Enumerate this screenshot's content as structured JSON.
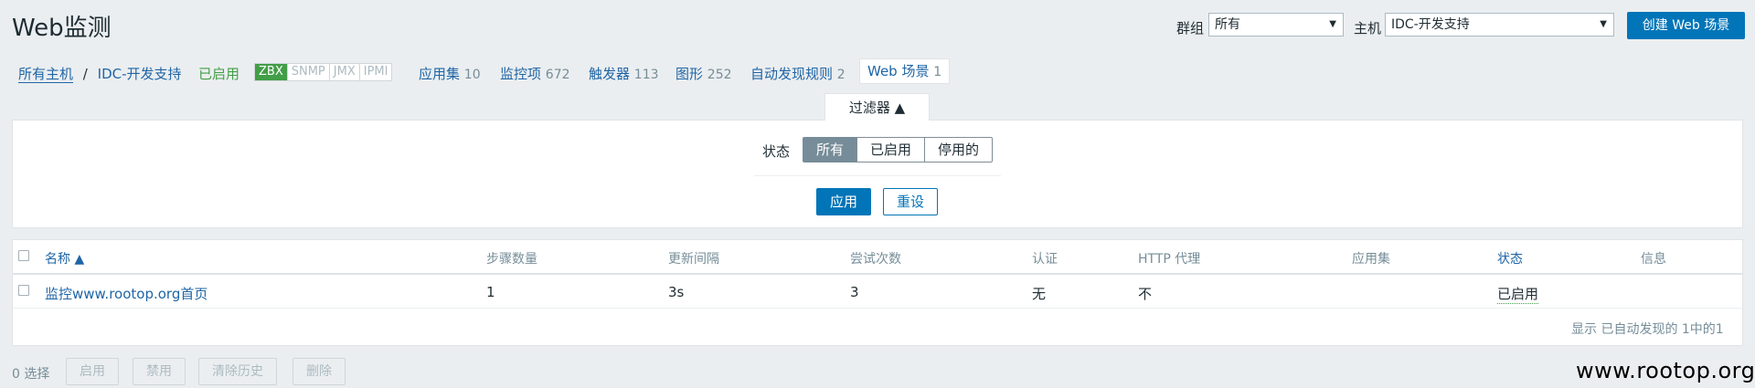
{
  "header": {
    "title": "Web监测",
    "group_label": "群组",
    "group_value": "所有",
    "host_label": "主机",
    "host_value": "IDC-开发支持",
    "create_button": "创建 Web 场景"
  },
  "nav": {
    "all_hosts": "所有主机",
    "separator": "/",
    "current_host": "IDC-开发支持",
    "host_status": "已启用",
    "availability": [
      "ZBX",
      "SNMP",
      "JMX",
      "IPMI"
    ],
    "links": [
      {
        "label": "应用集",
        "count": "10"
      },
      {
        "label": "监控项",
        "count": "672"
      },
      {
        "label": "触发器",
        "count": "113"
      },
      {
        "label": "图形",
        "count": "252"
      },
      {
        "label": "自动发现规则",
        "count": "2"
      }
    ],
    "active_tab": {
      "label": "Web 场景",
      "count": "1"
    }
  },
  "filter": {
    "tab_label": "过滤器 ▲",
    "status_label": "状态",
    "options": [
      "所有",
      "已启用",
      "停用的"
    ],
    "apply": "应用",
    "reset": "重设"
  },
  "table": {
    "columns": [
      "名称 ▲",
      "步骤数量",
      "更新间隔",
      "尝试次数",
      "认证",
      "HTTP 代理",
      "应用集",
      "状态",
      "信息"
    ],
    "rows": [
      {
        "name": "监控www.rootop.org首页",
        "steps": "1",
        "interval": "3s",
        "attempts": "3",
        "auth": "无",
        "proxy": "不",
        "app": "",
        "status": "已启用",
        "info": ""
      }
    ],
    "footer": "显示 已自动发现的 1中的1"
  },
  "actions": {
    "selected": "0 选择",
    "enable": "启用",
    "disable": "禁用",
    "clear_history": "清除历史",
    "delete": "删除"
  },
  "watermark": "www.rootop.org",
  "colors": {
    "primary": "#0275b8",
    "link": "#1f65a6",
    "enabled": "#429e47",
    "muted": "#768d99"
  }
}
